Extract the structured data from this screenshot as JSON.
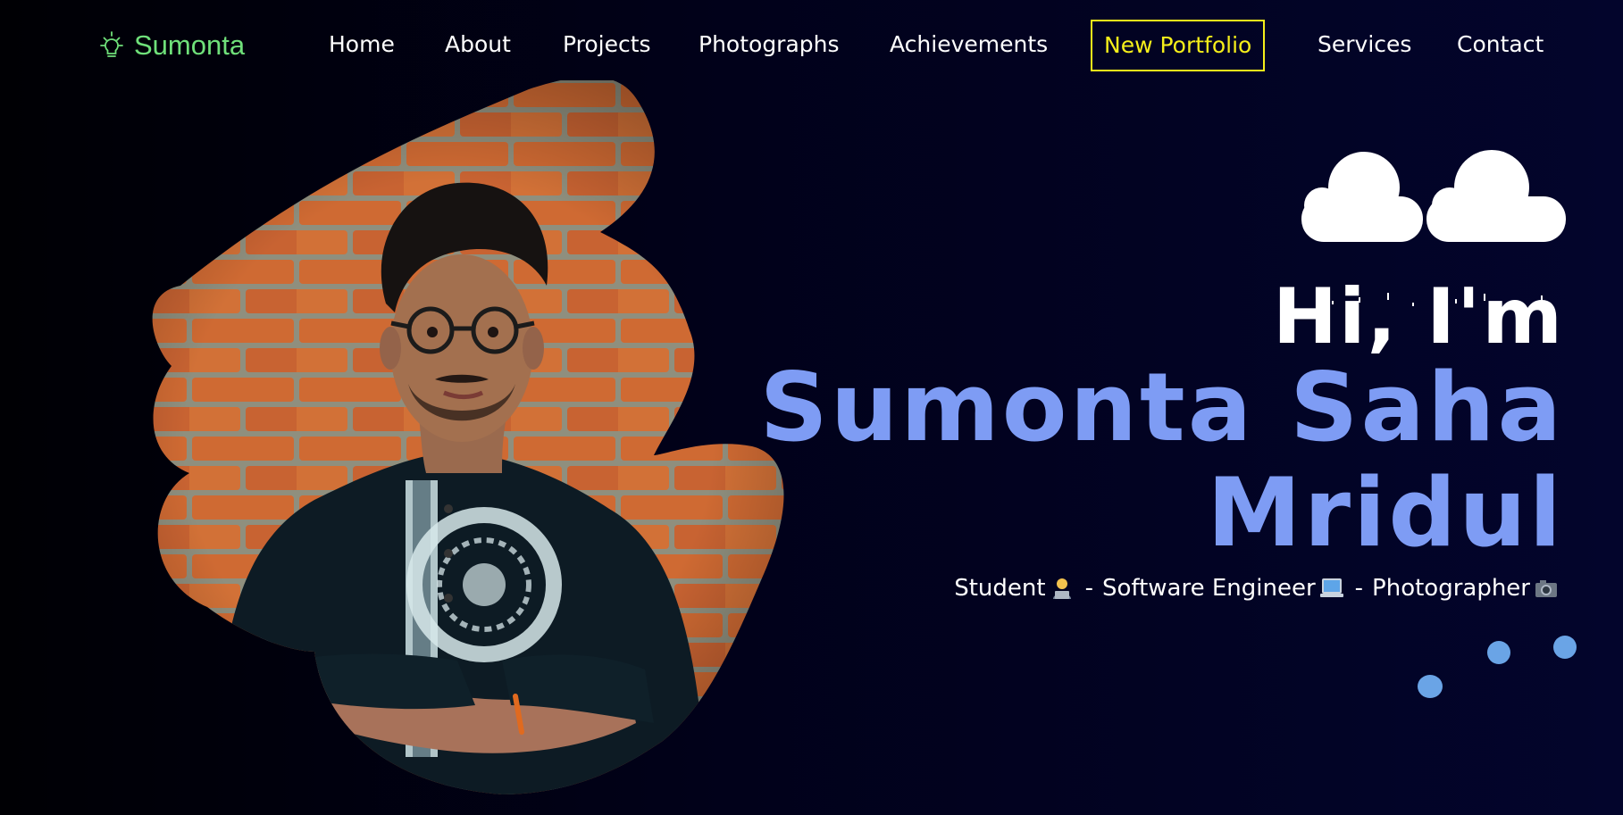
{
  "brand": {
    "name": "Sumonta",
    "icon": "lightbulb-icon",
    "color": "#6fe07a"
  },
  "nav": {
    "items": [
      {
        "label": "Home"
      },
      {
        "label": "About"
      },
      {
        "label": "Projects"
      },
      {
        "label": "Photographs"
      },
      {
        "label": "Achievements"
      },
      {
        "label": "New Portfolio",
        "highlight": true
      },
      {
        "label": "Services"
      },
      {
        "label": "Contact"
      }
    ],
    "highlight_color": "#f6ef1a"
  },
  "hero": {
    "greeting": "Hi, I'm",
    "name_line1": "Sumonta Saha",
    "name_line2": "Mridul",
    "name_color": "#7e9cf4",
    "tagline": {
      "role1": "Student",
      "role1_icon": "technologist-emoji",
      "sep1": "-",
      "role2": "Software Engineer",
      "role2_icon": "laptop-emoji",
      "sep2": "-",
      "role3": "Photographer",
      "role3_icon": "camera-emoji"
    }
  },
  "decor": {
    "clouds_icon": "cloud-icon",
    "dots_color": "#6aa4e6"
  }
}
